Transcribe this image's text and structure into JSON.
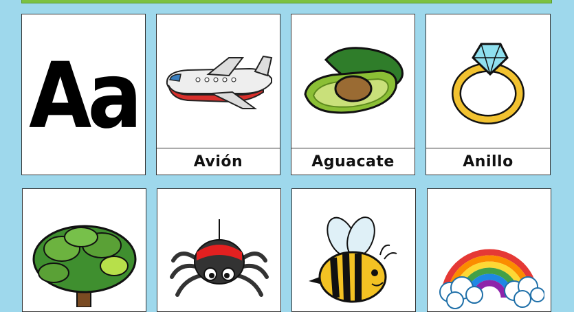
{
  "header": {
    "letter": "Aa"
  },
  "row1": [
    {
      "label": "Avión",
      "icon": "airplane-icon"
    },
    {
      "label": "Aguacate",
      "icon": "avocado-icon"
    },
    {
      "label": "Anillo",
      "icon": "ring-icon"
    }
  ],
  "row2": [
    {
      "icon": "tree-icon"
    },
    {
      "icon": "spider-icon"
    },
    {
      "icon": "bee-icon"
    },
    {
      "icon": "rainbow-icon"
    }
  ],
  "colors": {
    "background": "#9ed8ec",
    "top_bar": "#7cc142"
  }
}
